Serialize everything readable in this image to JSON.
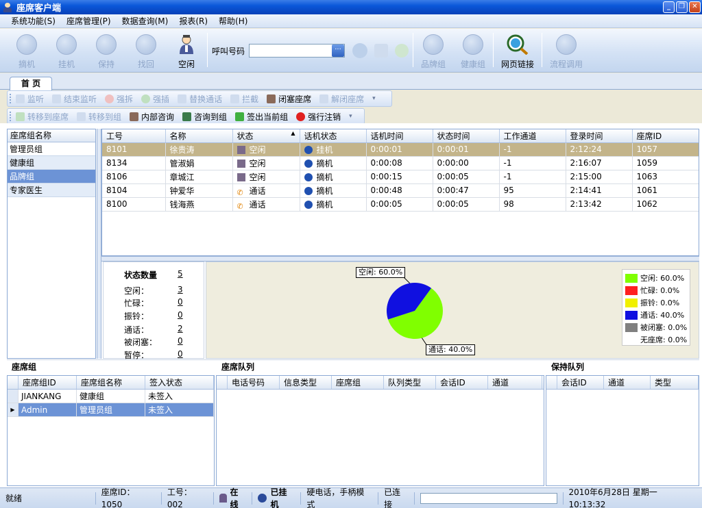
{
  "window": {
    "title": "座席客户端"
  },
  "menu": [
    "系统功能(S)",
    "座席管理(P)",
    "数据查询(M)",
    "报表(R)",
    "帮助(H)"
  ],
  "toolbar": {
    "answer": "摘机",
    "hangup": "挂机",
    "hold": "保持",
    "retrieve": "找回",
    "status": "空闲",
    "call_label": "呼叫号码",
    "call_value": "",
    "brand_group": "品牌组",
    "health_group": "健康组",
    "web_link": "网页链接",
    "flow_call": "流程调用"
  },
  "tab": {
    "home": "首 页"
  },
  "actions1": [
    "监听",
    "结束监听",
    "强拆",
    "强插",
    "替换通话",
    "拦截",
    "闭塞座席",
    "解闭座席"
  ],
  "actions2": [
    "转移到座席",
    "转移到组",
    "内部咨询",
    "咨询到组",
    "签出当前组",
    "强行注销"
  ],
  "groups": {
    "header": "座席组名称",
    "items": [
      "管理员组",
      "健康组",
      "品牌组",
      "专家医生"
    ]
  },
  "agents": {
    "columns": [
      "工号",
      "名称",
      "状态",
      "话机状态",
      "话机时间",
      "状态时间",
      "工作通道",
      "登录时间",
      "座席ID"
    ],
    "rows": [
      {
        "id": "8101",
        "name": "徐贵涛",
        "status": "空闲",
        "phone": "挂机",
        "ptime": "0:00:01",
        "stime": "0:00:01",
        "chan": "-1",
        "login": "2:12:24",
        "seat": "1057"
      },
      {
        "id": "8134",
        "name": "管淑娟",
        "status": "空闲",
        "phone": "摘机",
        "ptime": "0:00:08",
        "stime": "0:00:00",
        "chan": "-1",
        "login": "2:16:07",
        "seat": "1059"
      },
      {
        "id": "8106",
        "name": "章城江",
        "status": "空闲",
        "phone": "摘机",
        "ptime": "0:00:15",
        "stime": "0:00:05",
        "chan": "-1",
        "login": "2:15:00",
        "seat": "1063"
      },
      {
        "id": "8104",
        "name": "钟爱华",
        "status": "通话",
        "phone": "摘机",
        "ptime": "0:00:48",
        "stime": "0:00:47",
        "chan": "95",
        "login": "2:14:41",
        "seat": "1061"
      },
      {
        "id": "8100",
        "name": "钱海燕",
        "status": "通话",
        "phone": "摘机",
        "ptime": "0:00:05",
        "stime": "0:00:05",
        "chan": "98",
        "login": "2:13:42",
        "seat": "1062"
      }
    ]
  },
  "stats": {
    "title": "状态数量",
    "total": "5",
    "rows": [
      {
        "label": "空闲：",
        "value": "3"
      },
      {
        "label": "忙碌：",
        "value": "0"
      },
      {
        "label": "振铃：",
        "value": "0"
      },
      {
        "label": "通话：",
        "value": "2"
      },
      {
        "label": "被闭塞：",
        "value": "0"
      },
      {
        "label": "暂停：",
        "value": "0"
      }
    ]
  },
  "chart_data": {
    "type": "pie",
    "slices": [
      {
        "label": "空闲",
        "value": 60.0,
        "color": "#80ff00"
      },
      {
        "label": "忙碌",
        "value": 0.0,
        "color": "#ff2020"
      },
      {
        "label": "振铃",
        "value": 0.0,
        "color": "#f0f000"
      },
      {
        "label": "通话",
        "value": 40.0,
        "color": "#1010e0"
      },
      {
        "label": "被闭塞",
        "value": 0.0,
        "color": "#808080"
      },
      {
        "label": "无座席",
        "value": 0.0,
        "color": "#ffffff"
      }
    ],
    "callouts": [
      "空闲: 60.0%",
      "通话: 40.0%"
    ],
    "legend": [
      "空闲: 60.0%",
      "忙碌: 0.0%",
      "振铃: 0.0%",
      "通话: 40.0%",
      "被闭塞: 0.0%",
      "无座席: 0.0%"
    ],
    "legend_position": "right"
  },
  "sections": {
    "group": "座席组",
    "queue": "座席队列",
    "hold": "保持队列"
  },
  "group_table": {
    "columns": [
      "座席组ID",
      "座席组名称",
      "签入状态"
    ],
    "rows": [
      {
        "id": "JIANKANG",
        "name": "健康组",
        "state": "未签入"
      },
      {
        "id": "Admin",
        "name": "管理员组",
        "state": "未签入"
      }
    ]
  },
  "queue_table": {
    "columns": [
      "电话号码",
      "信息类型",
      "座席组",
      "队列类型",
      "会话ID",
      "通道"
    ]
  },
  "hold_table": {
    "columns": [
      "会话ID",
      "通道",
      "类型"
    ]
  },
  "status": {
    "ready": "就绪",
    "seat_id": "座席ID：1050",
    "work_id": "工号：002",
    "online": "在线",
    "hooked": "已挂机",
    "mode": "硬电话，手柄模式",
    "connected": "已连接",
    "datetime": "2010年6月28日  星期一  10:13:32"
  }
}
